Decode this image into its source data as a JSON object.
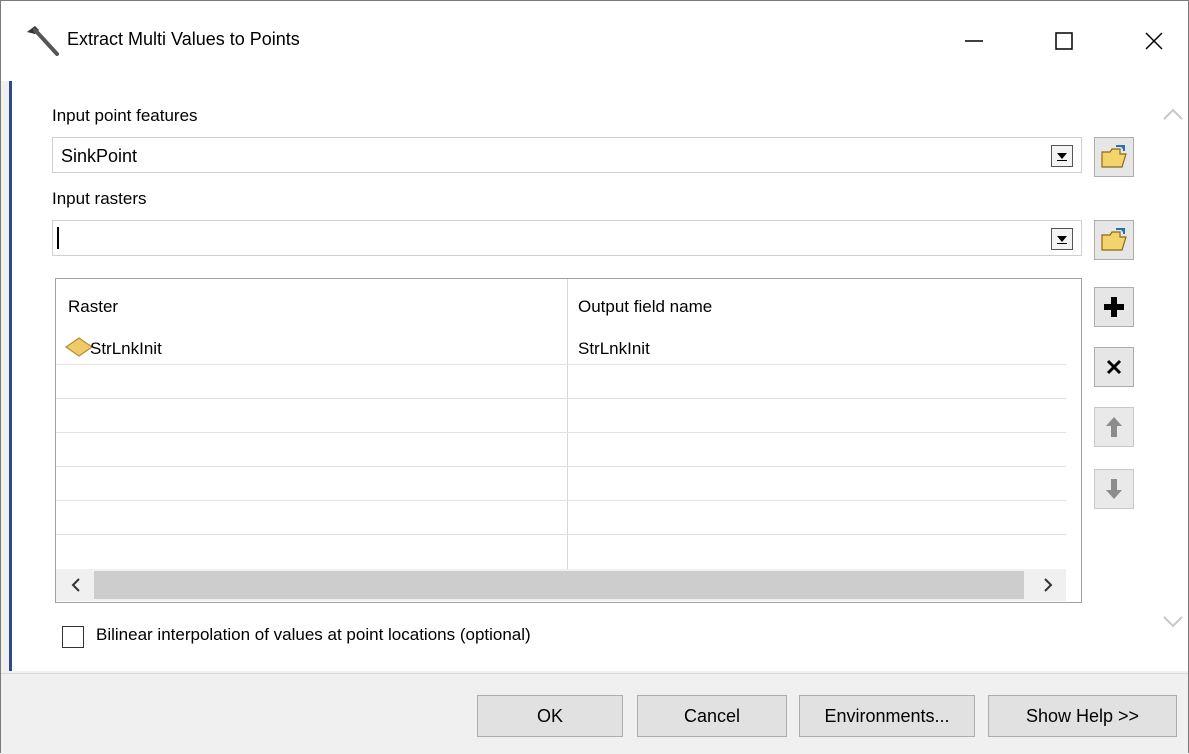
{
  "window": {
    "title": "Extract Multi Values to Points",
    "controls": {
      "minimize": "—",
      "maximize": "☐",
      "close": "✕"
    }
  },
  "form": {
    "input_point_features": {
      "label": "Input point features",
      "value": "SinkPoint"
    },
    "input_rasters": {
      "label": "Input rasters",
      "value": ""
    }
  },
  "grid": {
    "columns": [
      "Raster",
      "Output field name"
    ],
    "rows": [
      {
        "raster": "StrLnkInit",
        "output_field": "StrLnkInit",
        "icon": "raster-diamond-icon"
      }
    ]
  },
  "side_buttons": {
    "add": "+",
    "remove": "×",
    "move_up": "up-arrow",
    "move_down": "down-arrow"
  },
  "options": {
    "bilinear": {
      "label": "Bilinear interpolation of values at point locations (optional)",
      "checked": false
    }
  },
  "buttons": {
    "ok": "OK",
    "cancel": "Cancel",
    "environments": "Environments...",
    "show_help": "Show Help >>"
  },
  "colors": {
    "accent_border": "#2a4b8d",
    "diamond_fill": "#f0c96a",
    "folder_fill": "#f3d36b"
  }
}
